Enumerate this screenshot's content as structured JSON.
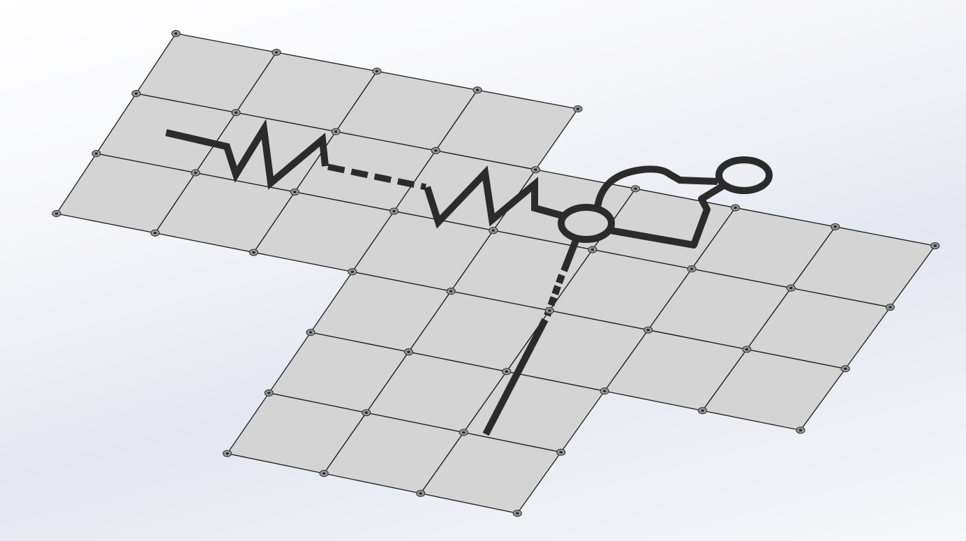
{
  "scene": {
    "panel_fill": "#d4d4d4",
    "grid_line_color": "#1c1c1c",
    "trace_color": "#2b2b2b",
    "background_colors": [
      "#ffffff",
      "#e4e7f0"
    ],
    "tile_layout_rows": [
      [
        0,
        1,
        2,
        3
      ],
      [
        0,
        1,
        2,
        3,
        4,
        5,
        6,
        7
      ],
      [
        0,
        1,
        2,
        3,
        4,
        5,
        6,
        7
      ],
      [
        3,
        4,
        5,
        6,
        7
      ],
      [
        3,
        4,
        5
      ],
      [
        3,
        4,
        5
      ]
    ]
  }
}
